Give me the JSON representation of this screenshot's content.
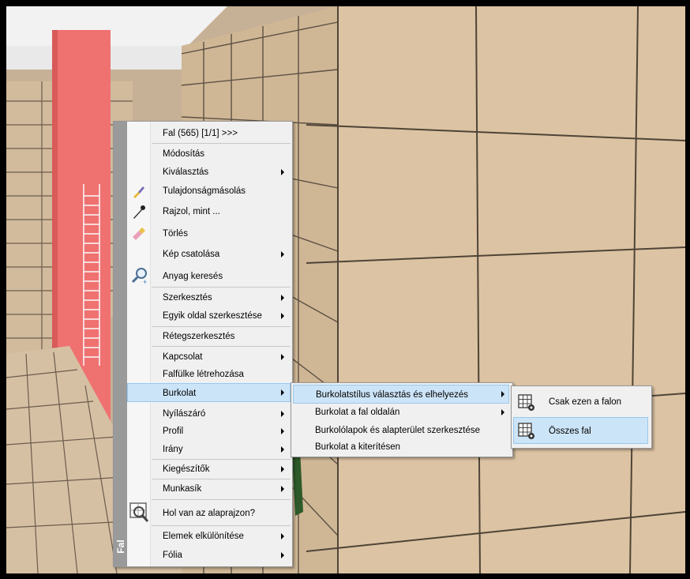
{
  "context_menu": {
    "side_label": "Fal",
    "items": [
      {
        "label": "Fal (565) [1/1] >>>",
        "submenu": false,
        "icon": null
      },
      {
        "label": "Módosítás",
        "submenu": false,
        "icon": null
      },
      {
        "label": "Kiválasztás",
        "submenu": true,
        "icon": null
      },
      {
        "label": "Tulajdonságmásolás",
        "submenu": false,
        "icon": "brush-icon"
      },
      {
        "label": "Rajzol, mint ...",
        "submenu": false,
        "icon": "pipette-icon"
      },
      {
        "label": "Törlés",
        "submenu": false,
        "icon": "eraser-icon"
      },
      {
        "label": "Kép csatolása",
        "submenu": true,
        "icon": null
      },
      {
        "label": "Anyag keresés",
        "submenu": false,
        "icon": "magnifier-icon"
      },
      {
        "label": "Szerkesztés",
        "submenu": true,
        "icon": null
      },
      {
        "label": "Egyik oldal szerkesztése",
        "submenu": true,
        "icon": null
      },
      {
        "label": "Rétegszerkesztés",
        "submenu": false,
        "icon": null
      },
      {
        "label": "Kapcsolat",
        "submenu": true,
        "icon": null
      },
      {
        "label": "Falfülke létrehozása",
        "submenu": false,
        "icon": null
      },
      {
        "label": "Burkolat",
        "submenu": true,
        "icon": null,
        "highlighted": true
      },
      {
        "label": "Nyílászáró",
        "submenu": true,
        "icon": null
      },
      {
        "label": "Profil",
        "submenu": true,
        "icon": null
      },
      {
        "label": "Irány",
        "submenu": true,
        "icon": null
      },
      {
        "label": "Kiegészítők",
        "submenu": true,
        "icon": null
      },
      {
        "label": "Munkasík",
        "submenu": true,
        "icon": null
      },
      {
        "label": "Hol van az alaprajzon?",
        "submenu": false,
        "icon": "floorplan-search-icon"
      },
      {
        "label": "Elemek elkülönítése",
        "submenu": true,
        "icon": null
      },
      {
        "label": "Fólia",
        "submenu": true,
        "icon": null
      }
    ]
  },
  "burkolat_submenu": {
    "items": [
      {
        "label": "Burkolatstílus választás és elhelyezés",
        "submenu": true,
        "highlighted": true
      },
      {
        "label": "Burkolat a fal oldalán",
        "submenu": true
      },
      {
        "label": "Burkolólapok és alapterület szerkesztése",
        "submenu": false
      },
      {
        "label": "Burkolat a kiterítésen",
        "submenu": false
      }
    ]
  },
  "style_submenu": {
    "items": [
      {
        "label": "Csak ezen a falon",
        "icon": "tile-grid-gear-icon"
      },
      {
        "label": "Összes fal",
        "icon": "tile-grid-gear-icon",
        "highlighted": true
      }
    ]
  },
  "colors": {
    "highlight_bg": "#cce4f7",
    "highlight_border": "#99c9ef",
    "menu_bg": "#f0f0f0",
    "side_strip": "#9a9a9a",
    "red_wall": "#ef7170",
    "tile": "#d8c0a2"
  }
}
